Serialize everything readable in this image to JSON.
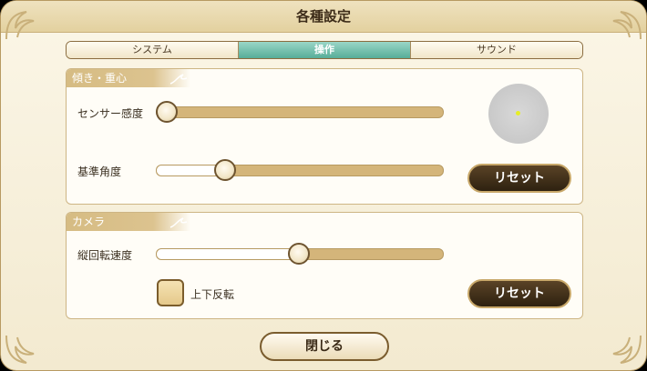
{
  "dialog": {
    "title": "各種設定"
  },
  "tabs": [
    {
      "label": "システム",
      "active": false
    },
    {
      "label": "操作",
      "active": true
    },
    {
      "label": "サウンド",
      "active": false
    }
  ],
  "tilt_panel": {
    "header": "傾き・重心",
    "sensor_sensitivity": {
      "label": "センサー感度",
      "value": 0.0
    },
    "reference_angle": {
      "label": "基準角度",
      "value": 0.22
    },
    "reset_label": "リセット"
  },
  "camera_panel": {
    "header": "カメラ",
    "vertical_rotation_speed": {
      "label": "縦回転速度",
      "value": 0.5
    },
    "invert_vertical": {
      "label": "上下反転",
      "checked": false
    },
    "reset_label": "リセット"
  },
  "close_label": "閉じる",
  "colors": {
    "accent_tab": "#57ad98",
    "panel_header": "#d6bc83",
    "dark_button": "#3a2a14",
    "gauge_dot": "#e6ee25"
  },
  "icons": [
    "corner-flourish-icon",
    "panel-flourish-icon"
  ]
}
